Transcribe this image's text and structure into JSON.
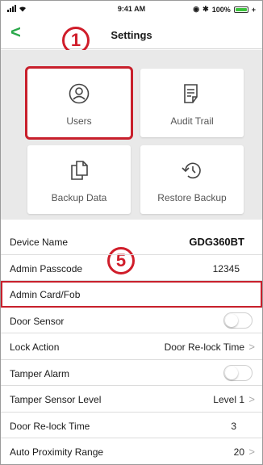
{
  "status_bar": {
    "time": "9:41 AM",
    "battery": "100%"
  },
  "nav": {
    "title": "Settings"
  },
  "callouts": {
    "one": "1",
    "five": "5"
  },
  "tiles": [
    {
      "label": "Users",
      "icon": "user-icon"
    },
    {
      "label": "Audit Trail",
      "icon": "notes-icon"
    },
    {
      "label": "Backup Data",
      "icon": "copy-icon"
    },
    {
      "label": "Restore Backup",
      "icon": "history-icon"
    }
  ],
  "settings": [
    {
      "label": "Device Name",
      "value": "GDG360BT"
    },
    {
      "label": "Admin Passcode",
      "value": "12345"
    },
    {
      "label": "Admin Card/Fob",
      "value": ""
    },
    {
      "label": "Door Sensor",
      "value": ""
    },
    {
      "label": "Lock Action",
      "value": "Door Re-lock Time"
    },
    {
      "label": "Tamper Alarm",
      "value": ""
    },
    {
      "label": "Tamper Sensor Level",
      "value": "Level 1"
    },
    {
      "label": "Door Re-lock Time",
      "value": "3"
    },
    {
      "label": "Auto Proximity Range",
      "value": "20"
    }
  ],
  "colors": {
    "accent": "#2aa84a",
    "highlight": "#c8202c",
    "battery": "#3cc43c"
  }
}
